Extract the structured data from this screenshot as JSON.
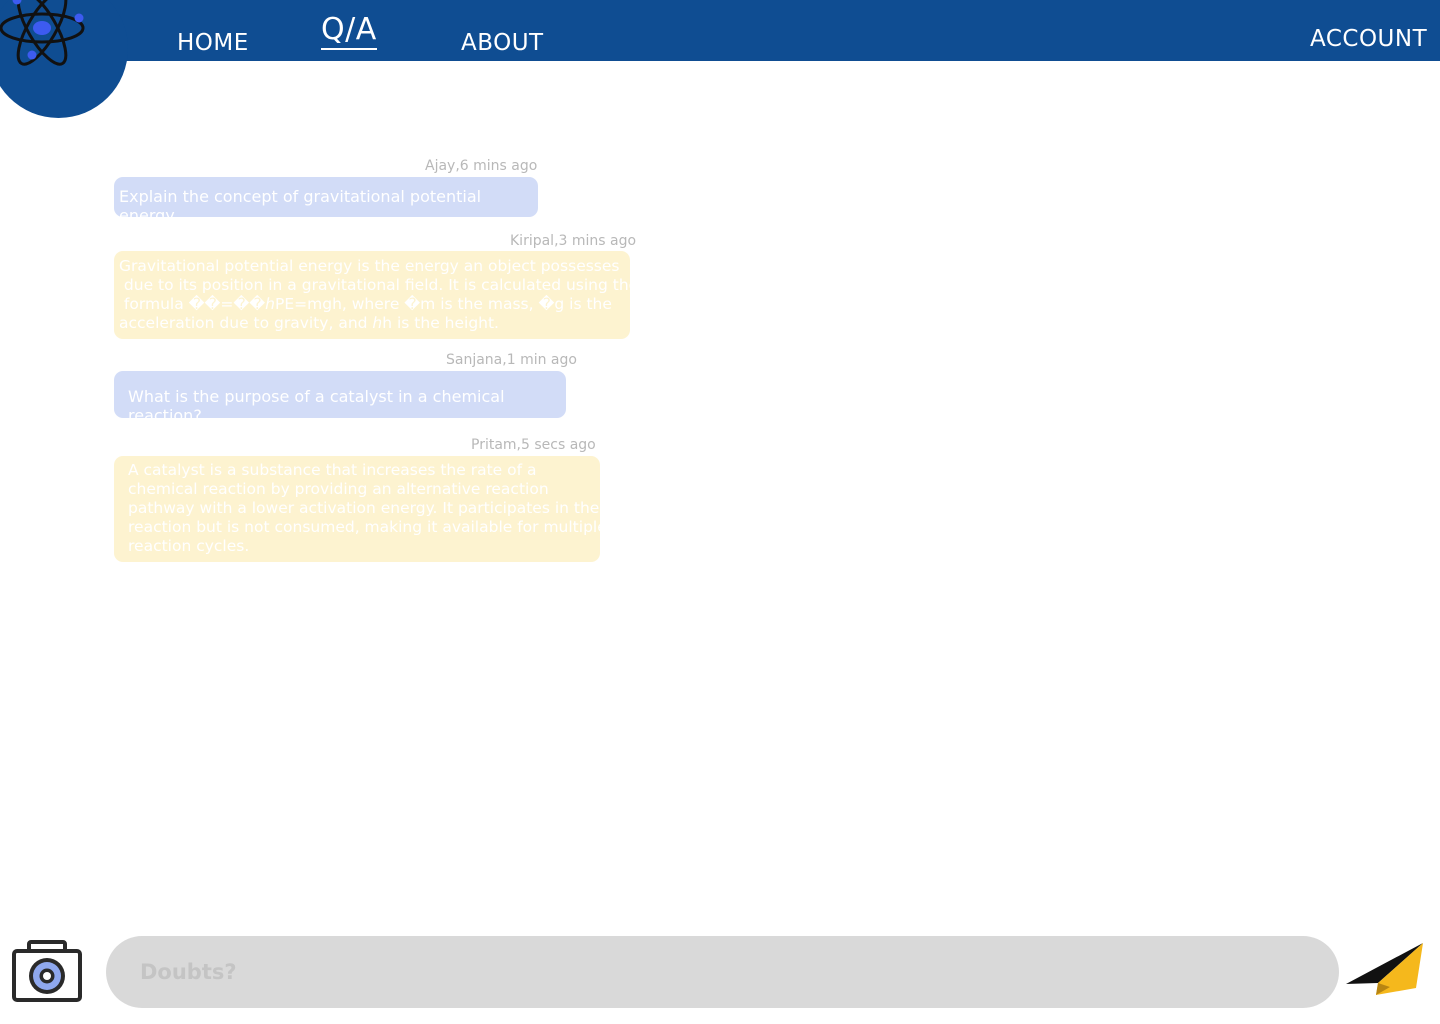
{
  "nav": {
    "home": "HOME",
    "qa": "Q/A",
    "about": "ABOUT",
    "account": "ACCOUNT"
  },
  "messages": [
    {
      "meta": "Ajay,6 mins ago",
      "text": "Explain the concept of gravitational potential energy",
      "kind": "question"
    },
    {
      "meta": "Kiripal,3 mins ago",
      "lines": [
        "Gravitational potential energy is the energy an object possesses",
        " due to its position in a gravitational field. It is calculated using the",
        " formula ��=��ℎPE=mgh, where �m is the mass, �g is the",
        "acceleration due to gravity, and ℎh is the height."
      ],
      "kind": "answer"
    },
    {
      "meta": "Sanjana,1 min ago",
      "text": "What is the purpose of a catalyst in a chemical reaction?",
      "kind": "question"
    },
    {
      "meta": "Pritam,5 secs ago",
      "lines": [
        "A catalyst is a substance that increases the rate of a",
        "chemical reaction by providing an alternative reaction",
        "pathway with a lower activation energy. It participates in the",
        "reaction but is not consumed, making it available for multiple",
        "reaction cycles."
      ],
      "kind": "answer"
    }
  ],
  "composer": {
    "placeholder": "Doubts?"
  },
  "icons": {
    "logo": "atom-icon",
    "camera": "camera-icon",
    "send": "paper-plane-icon"
  },
  "colors": {
    "brand": "#0f4d92",
    "question_bubble": "#d2dcf7",
    "answer_bubble": "#fdf3d0",
    "input_bg": "#d9d9d9",
    "send_accent": "#f5b81c"
  }
}
